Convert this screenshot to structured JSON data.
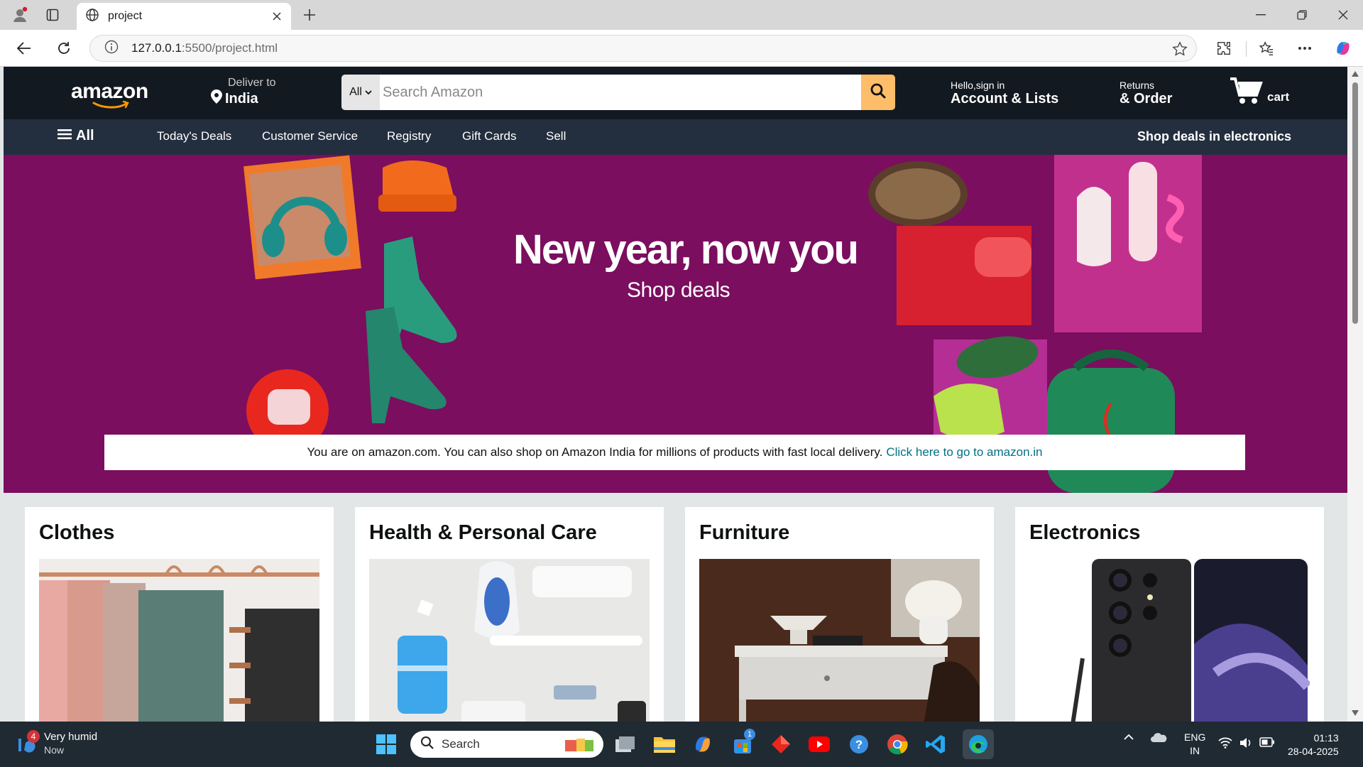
{
  "browser": {
    "tab_title": "project",
    "url_host": "127.0.0.1",
    "url_rest": ":5500/project.html"
  },
  "header": {
    "logo": "amazon",
    "deliver_line1": "Deliver to",
    "deliver_line2": "India",
    "search_category": "All",
    "search_placeholder": "Search Amazon",
    "account_line1": "Hello,sign in",
    "account_line2": "Account & Lists",
    "returns_line1": "Returns",
    "returns_line2": "& Order",
    "cart_label": "cart"
  },
  "nav": {
    "all_label": "All",
    "links": [
      "Today's Deals",
      "Customer Service",
      "Registry",
      "Gift Cards",
      "Sell"
    ],
    "right_label": "Shop deals in electronics"
  },
  "hero": {
    "title": "New year, now you",
    "subtitle": "Shop deals",
    "notice_text": "You are on amazon.com. You can also shop on Amazon India for millions of products with fast local delivery.",
    "notice_link": "Click here to go to amazon.in"
  },
  "cards": [
    {
      "title": "Clothes"
    },
    {
      "title": "Health & Personal Care"
    },
    {
      "title": "Furniture"
    },
    {
      "title": "Electronics"
    }
  ],
  "taskbar": {
    "weather_badge": "4",
    "weather_title": "Very humid",
    "weather_time": "Now",
    "search_label": "Search",
    "store_badge": "1",
    "lang_line1": "ENG",
    "lang_line2": "IN",
    "time": "01:13",
    "date": "28-04-2025"
  },
  "colors": {
    "amazon_header": "#131921",
    "amazon_nav": "#232f3e",
    "search_button": "#febd69",
    "hero_bg": "#7b0e5e",
    "link": "#007185"
  }
}
